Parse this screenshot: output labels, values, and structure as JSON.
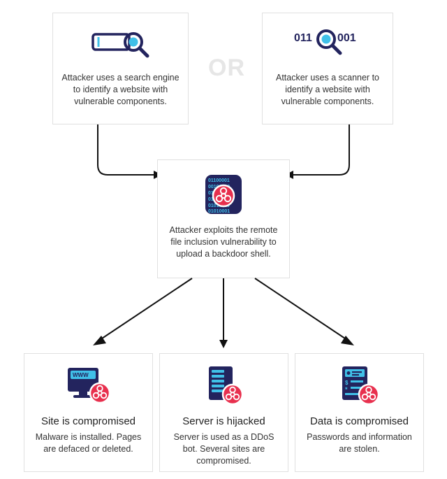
{
  "diagram": {
    "or_label": "OR",
    "top_left": {
      "text": "Attacker uses a search engine to identify a website with vulnerable components."
    },
    "top_right": {
      "text": "Attacker uses a scanner to identify a website with vulnerable components."
    },
    "middle": {
      "text": "Attacker exploits the remote file inclusion vulnerability to upload a backdoor shell."
    },
    "bottom_left": {
      "title": "Site is compromised",
      "text": "Malware is installed. Pages are defaced or deleted."
    },
    "bottom_center": {
      "title": "Server is hijacked",
      "text": "Server is used as a DDoS bot. Several sites are compromised."
    },
    "bottom_right": {
      "title": "Data is compromised",
      "text": "Passwords and information are stolen."
    }
  },
  "colors": {
    "navy": "#23245e",
    "red": "#e8304e",
    "cyan": "#40c0e8"
  }
}
